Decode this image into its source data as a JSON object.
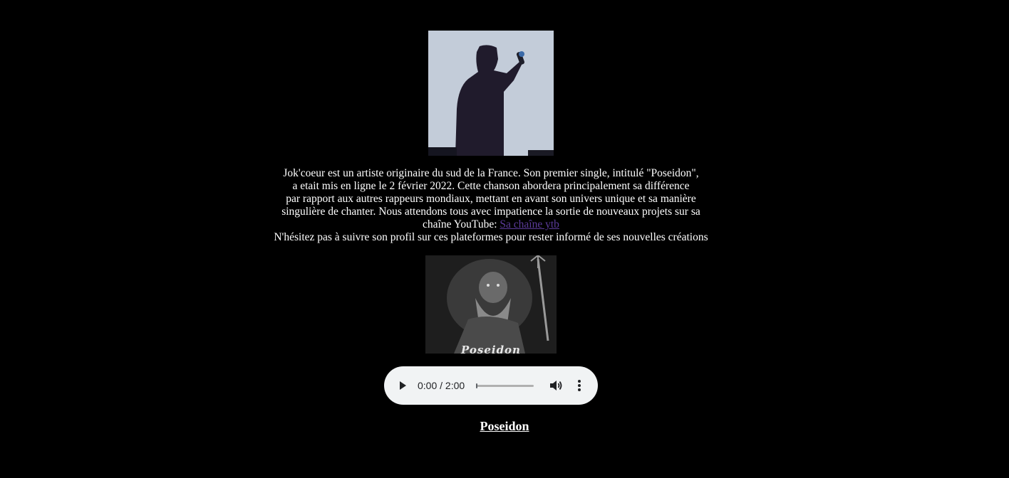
{
  "artist_photo": {
    "alt": "Jok'coeur"
  },
  "bio": {
    "line1": "Jok'coeur est un artiste originaire du sud de la France. Son premier single, intitulé \"Poseidon\",",
    "line2": "a etait mis en ligne le 2 février 2022. Cette chanson abordera principalement sa différence",
    "line3": "par rapport aux autres rappeurs mondiaux, mettant en avant son univers unique et sa manière",
    "line4": "singulière de chanter. Nous attendons tous avec impatience la sortie de nouveaux projets sur sa",
    "line5_prefix": "chaîne YouTube: ",
    "youtube_link": "Sa chaîne ytb",
    "line6": "N'hésitez pas à suivre son profil sur ces plateformes pour rester informé de ses nouvelles créations"
  },
  "cover": {
    "title_text": "Poseidon"
  },
  "player": {
    "time_display": "0:00 / 2:00",
    "progress_fraction": 0.0,
    "icons": {
      "play": "play-icon",
      "volume": "volume-icon",
      "menu": "more-vertical-icon"
    }
  },
  "song": {
    "title": "Poseidon"
  },
  "colors": {
    "background": "#000000",
    "text": "#ffffff",
    "link": "#5b3b9a",
    "player_bg": "#f1f3f4"
  }
}
